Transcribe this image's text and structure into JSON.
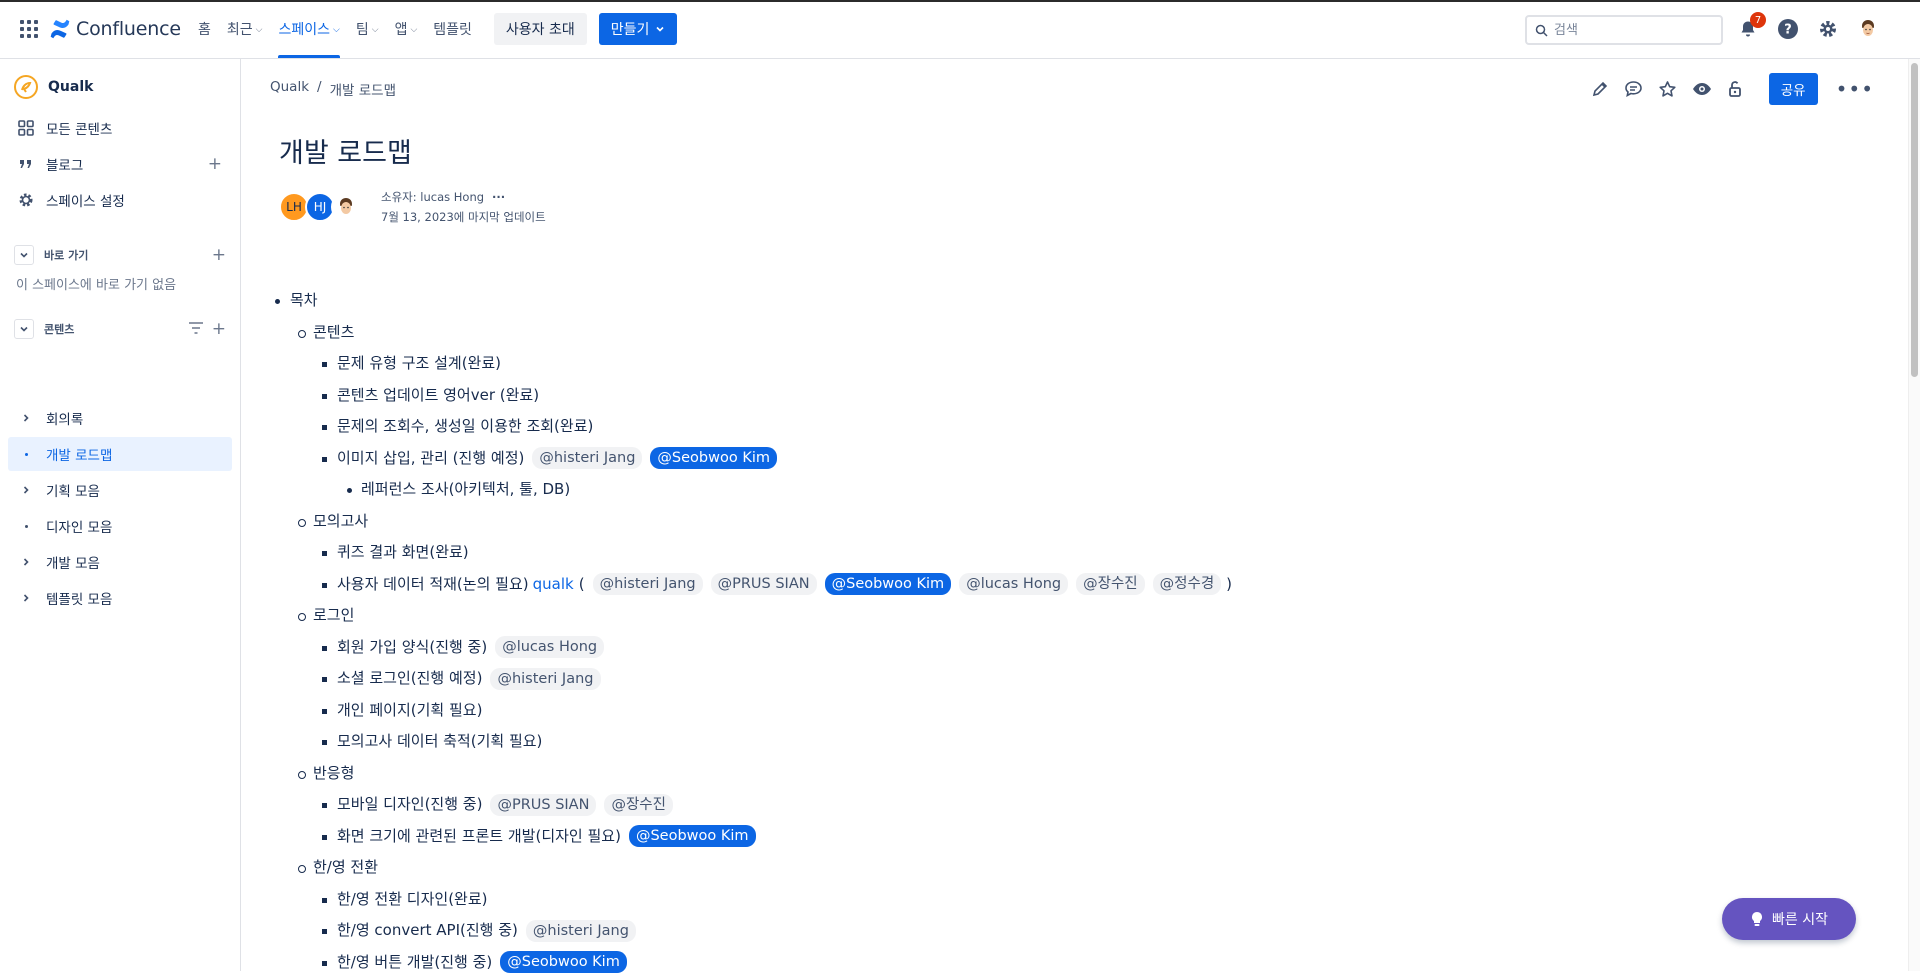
{
  "topbar": {
    "product": "Confluence",
    "nav": [
      {
        "label": "홈",
        "chevron": false,
        "active": false
      },
      {
        "label": "최근",
        "chevron": true,
        "active": false
      },
      {
        "label": "스페이스",
        "chevron": true,
        "active": true
      },
      {
        "label": "팀",
        "chevron": true,
        "active": false
      },
      {
        "label": "앱",
        "chevron": true,
        "active": false
      },
      {
        "label": "템플릿",
        "chevron": false,
        "active": false
      }
    ],
    "invite_label": "사용자 초대",
    "create_label": "만들기",
    "search_placeholder": "검색",
    "notification_count": "7",
    "icons": [
      "app-switcher-icon",
      "bell-icon",
      "help-icon",
      "settings-icon",
      "avatar"
    ]
  },
  "sidebar": {
    "space_name": "Qualk",
    "items": [
      {
        "label": "모든 콘텐츠",
        "icon": "grid-icon"
      },
      {
        "label": "블로그",
        "icon": "quote-icon"
      },
      {
        "label": "스페이스 설정",
        "icon": "gear-icon"
      }
    ],
    "shortcuts_header": "바로 가기",
    "shortcuts_empty": "이 스페이스에 바로 가기 없음",
    "content_header": "콘텐츠",
    "tree": [
      {
        "label": "회의록",
        "marker": "chevron"
      },
      {
        "label": "개발 로드맵",
        "marker": "dot",
        "selected": true
      },
      {
        "label": "기획 모음",
        "marker": "chevron"
      },
      {
        "label": "디자인 모음",
        "marker": "dot"
      },
      {
        "label": "개발 모음",
        "marker": "chevron"
      },
      {
        "label": "템플릿 모음",
        "marker": "chevron"
      }
    ]
  },
  "page": {
    "breadcrumb": [
      "Qualk",
      "/",
      "개발 로드맵"
    ],
    "share_label": "공유",
    "title": "개발 로드맵",
    "contributors": [
      {
        "initials": "LH",
        "color": "#ff991f"
      },
      {
        "initials": "HJ",
        "color": "#0c66e4"
      }
    ],
    "owner": "소유자: lucas Hong",
    "updated": "7월 13, 2023에 마지막 업데이트"
  },
  "outline": [
    {
      "level": 1,
      "text": "목차"
    },
    {
      "level": 2,
      "text": "콘텐츠"
    },
    {
      "level": 3,
      "text": "문제 유형 구조 설계(완료)"
    },
    {
      "level": 3,
      "text": "콘텐츠 업데이트 영어ver (완료)"
    },
    {
      "level": 3,
      "text": "문제의 조회수, 생성일 이용한 조회(완료)"
    },
    {
      "level": 3,
      "text": "이미지 삽입, 관리 (진행 예정)",
      "mentions": [
        {
          "name": "@histeri Jang"
        },
        {
          "name": "@Seobwoo Kim",
          "me": true
        }
      ]
    },
    {
      "level": 4,
      "text": "레퍼런스 조사(아키텍처, 툴, DB)"
    },
    {
      "level": 2,
      "text": "모의고사"
    },
    {
      "level": 3,
      "text": "퀴즈 결과 화면(완료)"
    },
    {
      "level": 3,
      "text": "사용자 데이터 적재(논의 필요)",
      "link": "qualk",
      "open": "(",
      "close": ")",
      "mentions": [
        {
          "name": "@histeri Jang"
        },
        {
          "name": "@PRUS SIAN"
        },
        {
          "name": "@Seobwoo Kim",
          "me": true
        },
        {
          "name": "@lucas Hong"
        },
        {
          "name": "@장수진"
        },
        {
          "name": "@정수경"
        }
      ]
    },
    {
      "level": 2,
      "text": "로그인"
    },
    {
      "level": 3,
      "text": "회원 가입 양식(진행 중)",
      "mentions": [
        {
          "name": "@lucas Hong"
        }
      ]
    },
    {
      "level": 3,
      "text": "소셜 로그인(진행 예정)",
      "mentions": [
        {
          "name": "@histeri Jang"
        }
      ]
    },
    {
      "level": 3,
      "text": "개인 페이지(기획 필요)"
    },
    {
      "level": 3,
      "text": "모의고사 데이터 축적(기획 필요)"
    },
    {
      "level": 2,
      "text": "반응형"
    },
    {
      "level": 3,
      "text": "모바일 디자인(진행 중)",
      "mentions": [
        {
          "name": "@PRUS SIAN"
        },
        {
          "name": "@장수진"
        }
      ]
    },
    {
      "level": 3,
      "text": "화면 크기에 관련된 프론트 개발(디자인 필요)",
      "mentions": [
        {
          "name": "@Seobwoo Kim",
          "me": true
        }
      ]
    },
    {
      "level": 2,
      "text": "한/영 전환"
    },
    {
      "level": 3,
      "text": "한/영 전환 디자인(완료)"
    },
    {
      "level": 3,
      "text": "한/영 convert API(진행 중)",
      "mentions": [
        {
          "name": "@histeri Jang"
        }
      ]
    },
    {
      "level": 3,
      "text": "한/영 버튼 개발(진행 중)",
      "mentions": [
        {
          "name": "@Seobwoo Kim",
          "me": true
        }
      ]
    }
  ],
  "quick_start_label": "빠른 시작",
  "colors": {
    "brand": "#0c66e4",
    "quick_start": "#6554c0",
    "badge": "#de350b"
  }
}
